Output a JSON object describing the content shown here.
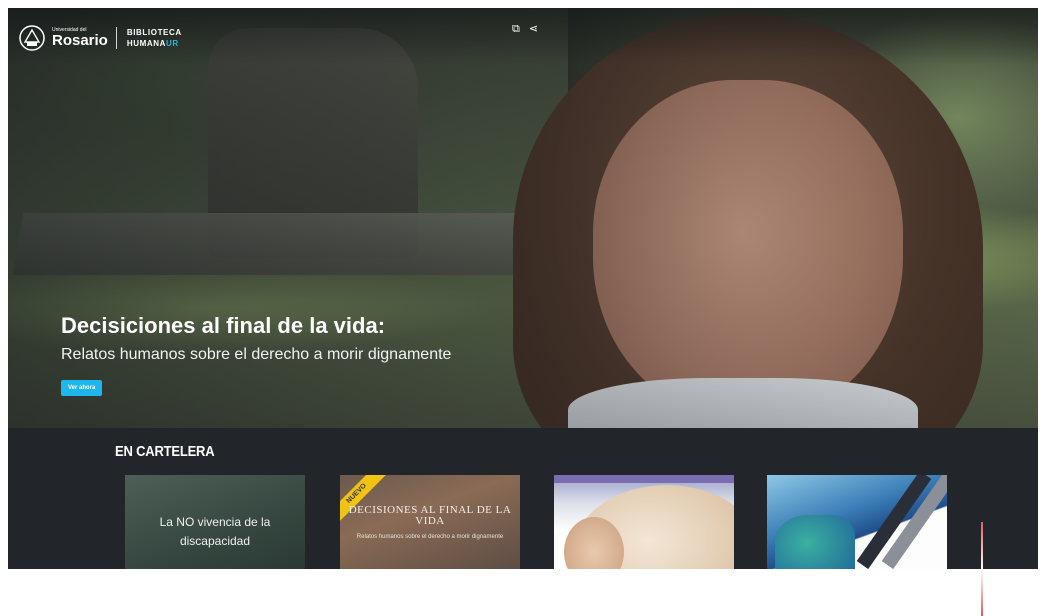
{
  "header": {
    "university_small": "Universidad del",
    "university_name": "Rosario",
    "library_line1": "BIBLIOTECA",
    "library_line2_main": "HUMANA",
    "library_line2_accent": "UR",
    "icons": [
      "window-icon",
      "share-icon"
    ],
    "accent_color": "#27b5e6"
  },
  "hero": {
    "title": "Decisiciones al final de la vida:",
    "subtitle": "Relatos humanos sobre el derecho a morir dignamente",
    "cta_label": "Ver ahora",
    "cta_color": "#1fb6ee"
  },
  "cartelera": {
    "title": "EN CARTELERA",
    "cards": [
      {
        "text": "La NO vivencia de la discapacidad"
      },
      {
        "ribbon": "NUEVO",
        "title": "DECISIONES AL FINAL DE LA VIDA",
        "subtitle": "Relatos humanos sobre el derecho a morir dignamente"
      },
      {
        "image": "head-wrap-portrait"
      },
      {
        "image": "abstract-map-collage"
      }
    ]
  }
}
